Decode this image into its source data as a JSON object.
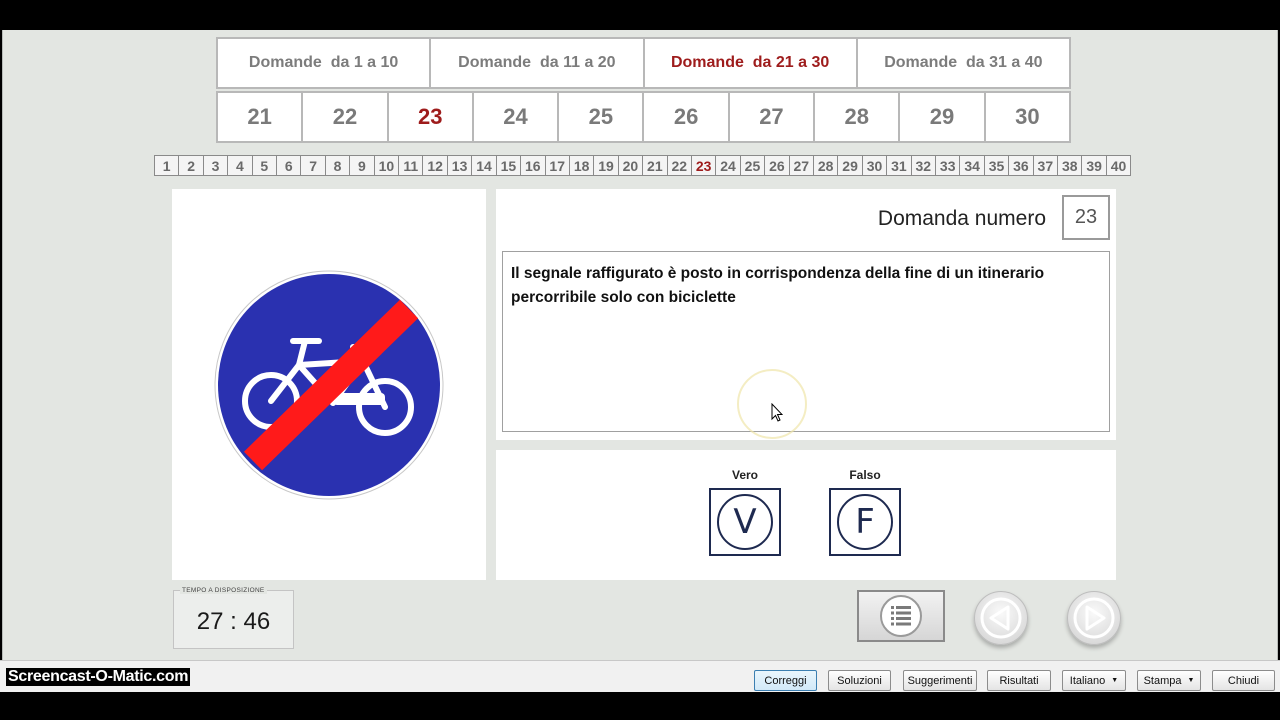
{
  "range_tabs": [
    {
      "label": "Domande  da 1 a 10",
      "active": false
    },
    {
      "label": "Domande  da 11 a 20",
      "active": false
    },
    {
      "label": "Domande  da 21 a 30",
      "active": true
    },
    {
      "label": "Domande  da 31 a 40",
      "active": false
    }
  ],
  "question_tabs": [
    "21",
    "22",
    "23",
    "24",
    "25",
    "26",
    "27",
    "28",
    "29",
    "30"
  ],
  "active_question": "23",
  "strip": [
    "1",
    "2",
    "3",
    "4",
    "5",
    "6",
    "7",
    "8",
    "9",
    "10",
    "11",
    "12",
    "13",
    "14",
    "15",
    "16",
    "17",
    "18",
    "19",
    "20",
    "21",
    "22",
    "23",
    "24",
    "25",
    "26",
    "27",
    "28",
    "29",
    "30",
    "31",
    "32",
    "33",
    "34",
    "35",
    "36",
    "37",
    "38",
    "39",
    "40"
  ],
  "question": {
    "label": "Domanda numero",
    "number": "23",
    "text": "Il segnale raffigurato è posto in corrispondenza della fine di un itinerario percorribile solo con biciclette"
  },
  "answers": {
    "true_label": "Vero",
    "true_glyph": "V",
    "false_label": "Falso",
    "false_glyph": "F"
  },
  "timer": {
    "label": "TEMPO A DISPOSIZIONE",
    "value": "27 : 46"
  },
  "sign": {
    "icon": "end-of-cycle-path-sign",
    "colors": {
      "blue": "#2a31b0",
      "red": "#ff1a1a",
      "white": "#ffffff"
    }
  },
  "watermark": "Screencast-O-Matic.com",
  "bottom_buttons": {
    "correggi": "Correggi",
    "soluzioni": "Soluzioni",
    "suggerimenti": "Suggerimenti",
    "risultati": "Risultati",
    "italiano": "Italiano",
    "stampa": "Stampa",
    "chiudi": "Chiudi"
  },
  "colors": {
    "active_red": "#9e1c1c",
    "app_bg": "#e3e6e2",
    "answer_navy": "#1e2a50"
  }
}
